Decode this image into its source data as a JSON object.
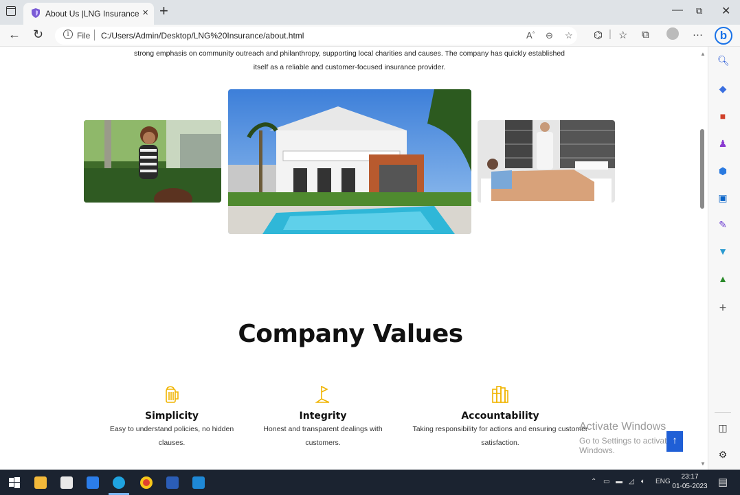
{
  "browser": {
    "tab_title": "About Us |LNG Insurance",
    "url_scheme": "File",
    "url": "C:/Users/Admin/Desktop/LNG%20Insurance/about.html",
    "new_tab_glyph": "+",
    "close_tab_glyph": "×"
  },
  "intro": {
    "line1": "strong emphasis on community outreach and philanthropy, supporting local charities and causes. The company has quickly established",
    "line2": "itself as a reliable and customer-focused insurance provider."
  },
  "values": {
    "title": "Company Values",
    "accent_color": "#f0b400",
    "items": [
      {
        "icon": "beer-mug-icon",
        "title": "Simplicity",
        "desc1": "Easy to understand policies, no hidden",
        "desc2": "clauses."
      },
      {
        "icon": "flag-icon",
        "title": "Integrity",
        "desc1": "Honest and transparent dealings with",
        "desc2": "customers."
      },
      {
        "icon": "books-icon",
        "title": "Accountability",
        "desc1": "Taking responsibility for actions and ensuring customer",
        "desc2": "satisfaction."
      }
    ]
  },
  "watermark": {
    "line1": "Activate Windows",
    "line2": "Go to Settings to activate Windows."
  },
  "scroll_top_glyph": "↑",
  "taskbar": {
    "time": "23:17",
    "date": "01-05-2023",
    "lang": "ENG"
  }
}
